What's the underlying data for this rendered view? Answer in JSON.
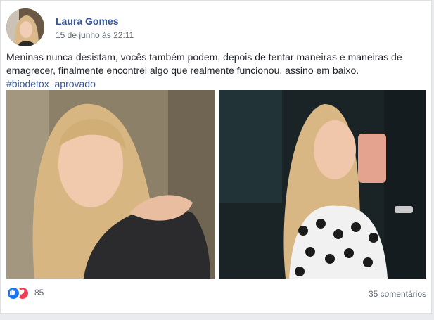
{
  "post": {
    "author": "Laura Gomes",
    "timestamp": "15 de junho às 22:11",
    "text": "Meninas nunca desistam, vocês também podem, depois de tentar maneiras e maneiras de emagrecer, finalmente encontrei algo que realmente funcionou, assino em baixo.",
    "hashtag": "#biodetox_aprovado"
  },
  "reactions": {
    "count": "85",
    "icons": [
      "like-icon",
      "love-icon"
    ],
    "colors": {
      "like": "#1877f2",
      "love": "#f33e58"
    }
  },
  "comments": {
    "label": "35 comentários"
  },
  "colors": {
    "link": "#385898",
    "text": "#1d2129",
    "meta": "#616770"
  }
}
